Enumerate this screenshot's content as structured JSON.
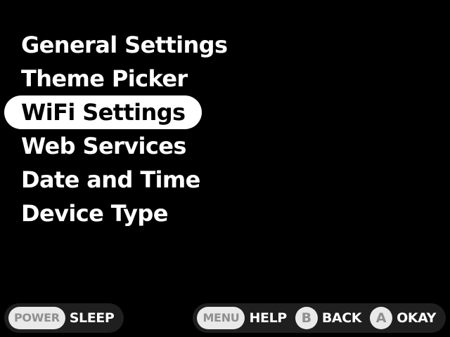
{
  "menu": {
    "items": [
      {
        "label": "General Settings"
      },
      {
        "label": "Theme Picker"
      },
      {
        "label": "WiFi Settings",
        "selected": true
      },
      {
        "label": "Web Services"
      },
      {
        "label": "Date and Time"
      },
      {
        "label": "Device Type"
      }
    ]
  },
  "footer": {
    "left": [
      {
        "key": "POWER",
        "label": "SLEEP"
      }
    ],
    "right": [
      {
        "key": "MENU",
        "label": "HELP"
      },
      {
        "key": "B",
        "label": "BACK"
      },
      {
        "key": "A",
        "label": "OKAY"
      }
    ]
  },
  "colors": {
    "background": "#000000",
    "text": "#ffffff",
    "highlight": "#ffffff",
    "button_face": "#e9e9e9",
    "button_text": "#8f8f8f",
    "footer_bg": "#1f1f1f"
  }
}
